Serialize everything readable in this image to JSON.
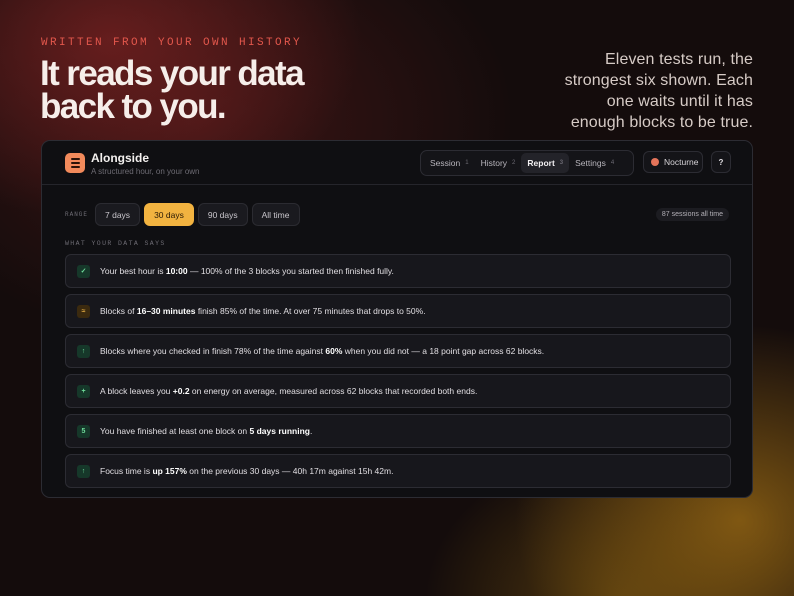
{
  "hero": {
    "eyebrow": "WRITTEN FROM YOUR OWN HISTORY",
    "headline": "It reads your data back to you.",
    "sidenote": "Eleven tests run, the strongest six shown. Each one waits until it has enough blocks to be true."
  },
  "app": {
    "name": "Alongside",
    "subtitle": "A structured hour, on your own",
    "icon": "menu-icon",
    "accent": "#f28a5b"
  },
  "nav": {
    "tabs": [
      {
        "label": "Session",
        "num": "1"
      },
      {
        "label": "History",
        "num": "2"
      },
      {
        "label": "Report",
        "num": "3",
        "active": true
      },
      {
        "label": "Settings",
        "num": "4"
      }
    ]
  },
  "theme": {
    "label": "Nocturne",
    "dot_color": "#e4745a"
  },
  "help": {
    "label": "?"
  },
  "range": {
    "label": "RANGE",
    "options": [
      "7 days",
      "30 days",
      "90 days",
      "All time"
    ],
    "selected": "30 days",
    "selected_color": "#f2b340"
  },
  "sessions_badge": "87 sessions all time",
  "section_label": "WHAT YOUR DATA SAYS",
  "insights": [
    {
      "icon": "check-icon",
      "glyph": "✓",
      "tone": "green",
      "parts": [
        {
          "t": "Your best hour is "
        },
        {
          "t": "10:00",
          "b": true
        },
        {
          "t": " — 100% of the 3 blocks you started then finished fully."
        }
      ]
    },
    {
      "icon": "approx-icon",
      "glyph": "≈",
      "tone": "amber",
      "parts": [
        {
          "t": "Blocks of "
        },
        {
          "t": "16–30 minutes",
          "b": true
        },
        {
          "t": " finish 85% of the time. At over 75 minutes that drops to 50%."
        }
      ]
    },
    {
      "icon": "arrow-up-icon",
      "glyph": "↑",
      "tone": "green",
      "parts": [
        {
          "t": "Blocks where you checked in finish 78% of the time against "
        },
        {
          "t": "60%",
          "b": true
        },
        {
          "t": " when you did not — a 18 point gap across 62 blocks."
        }
      ]
    },
    {
      "icon": "plus-icon",
      "glyph": "+",
      "tone": "green",
      "parts": [
        {
          "t": "A block leaves you "
        },
        {
          "t": "+0.2",
          "b": true
        },
        {
          "t": " on energy on average, measured across 62 blocks that recorded both ends."
        }
      ]
    },
    {
      "icon": "streak-count-icon",
      "glyph": "5",
      "tone": "green",
      "parts": [
        {
          "t": "You have finished at least one block on "
        },
        {
          "t": "5 days running",
          "b": true
        },
        {
          "t": "."
        }
      ]
    },
    {
      "icon": "arrow-up-icon",
      "glyph": "↑",
      "tone": "green",
      "parts": [
        {
          "t": "Focus time is "
        },
        {
          "t": "up 157%",
          "b": true
        },
        {
          "t": " on the previous 30 days — 40h 17m against 15h 42m."
        }
      ]
    }
  ]
}
